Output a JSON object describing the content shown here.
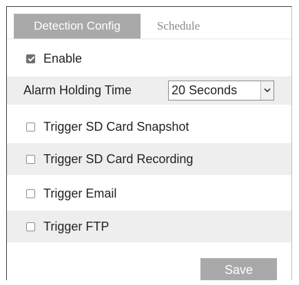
{
  "tabs": [
    {
      "label": "Detection Config",
      "active": true
    },
    {
      "label": "Schedule",
      "active": false
    }
  ],
  "enable": {
    "label": "Enable",
    "checked": true
  },
  "alarm_holding_time": {
    "label": "Alarm Holding Time",
    "selected": "20 Seconds"
  },
  "triggers": [
    {
      "label": "Trigger SD Card Snapshot",
      "checked": false
    },
    {
      "label": "Trigger SD Card Recording",
      "checked": false
    },
    {
      "label": "Trigger Email",
      "checked": false
    },
    {
      "label": "Trigger FTP",
      "checked": false
    }
  ],
  "save_label": "Save",
  "icons": {
    "dropdown": "chevron-down-icon",
    "checkbox_checked": "check-icon"
  },
  "colors": {
    "tab_active_bg": "#a9a9a9",
    "row_shade": "#eeeeee",
    "button_bg": "#a9a9a9"
  }
}
